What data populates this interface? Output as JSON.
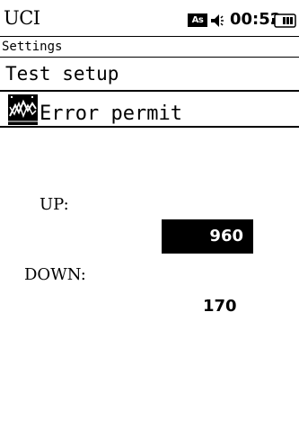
{
  "status_bar": {
    "app_title": "UCI",
    "mode_badge": "As",
    "clock": "00:52"
  },
  "breadcrumb": "Settings",
  "page_title": "Test setup",
  "menu": {
    "label": "Error permit",
    "icon": "error-chart-icon"
  },
  "fields": {
    "up": {
      "label": "UP:",
      "value": "960"
    },
    "down": {
      "label": "DOWN:",
      "value": "170"
    }
  },
  "colors": {
    "foreground": "#000000",
    "background": "#ffffff",
    "selected_bg": "#000000",
    "selected_fg": "#ffffff"
  }
}
